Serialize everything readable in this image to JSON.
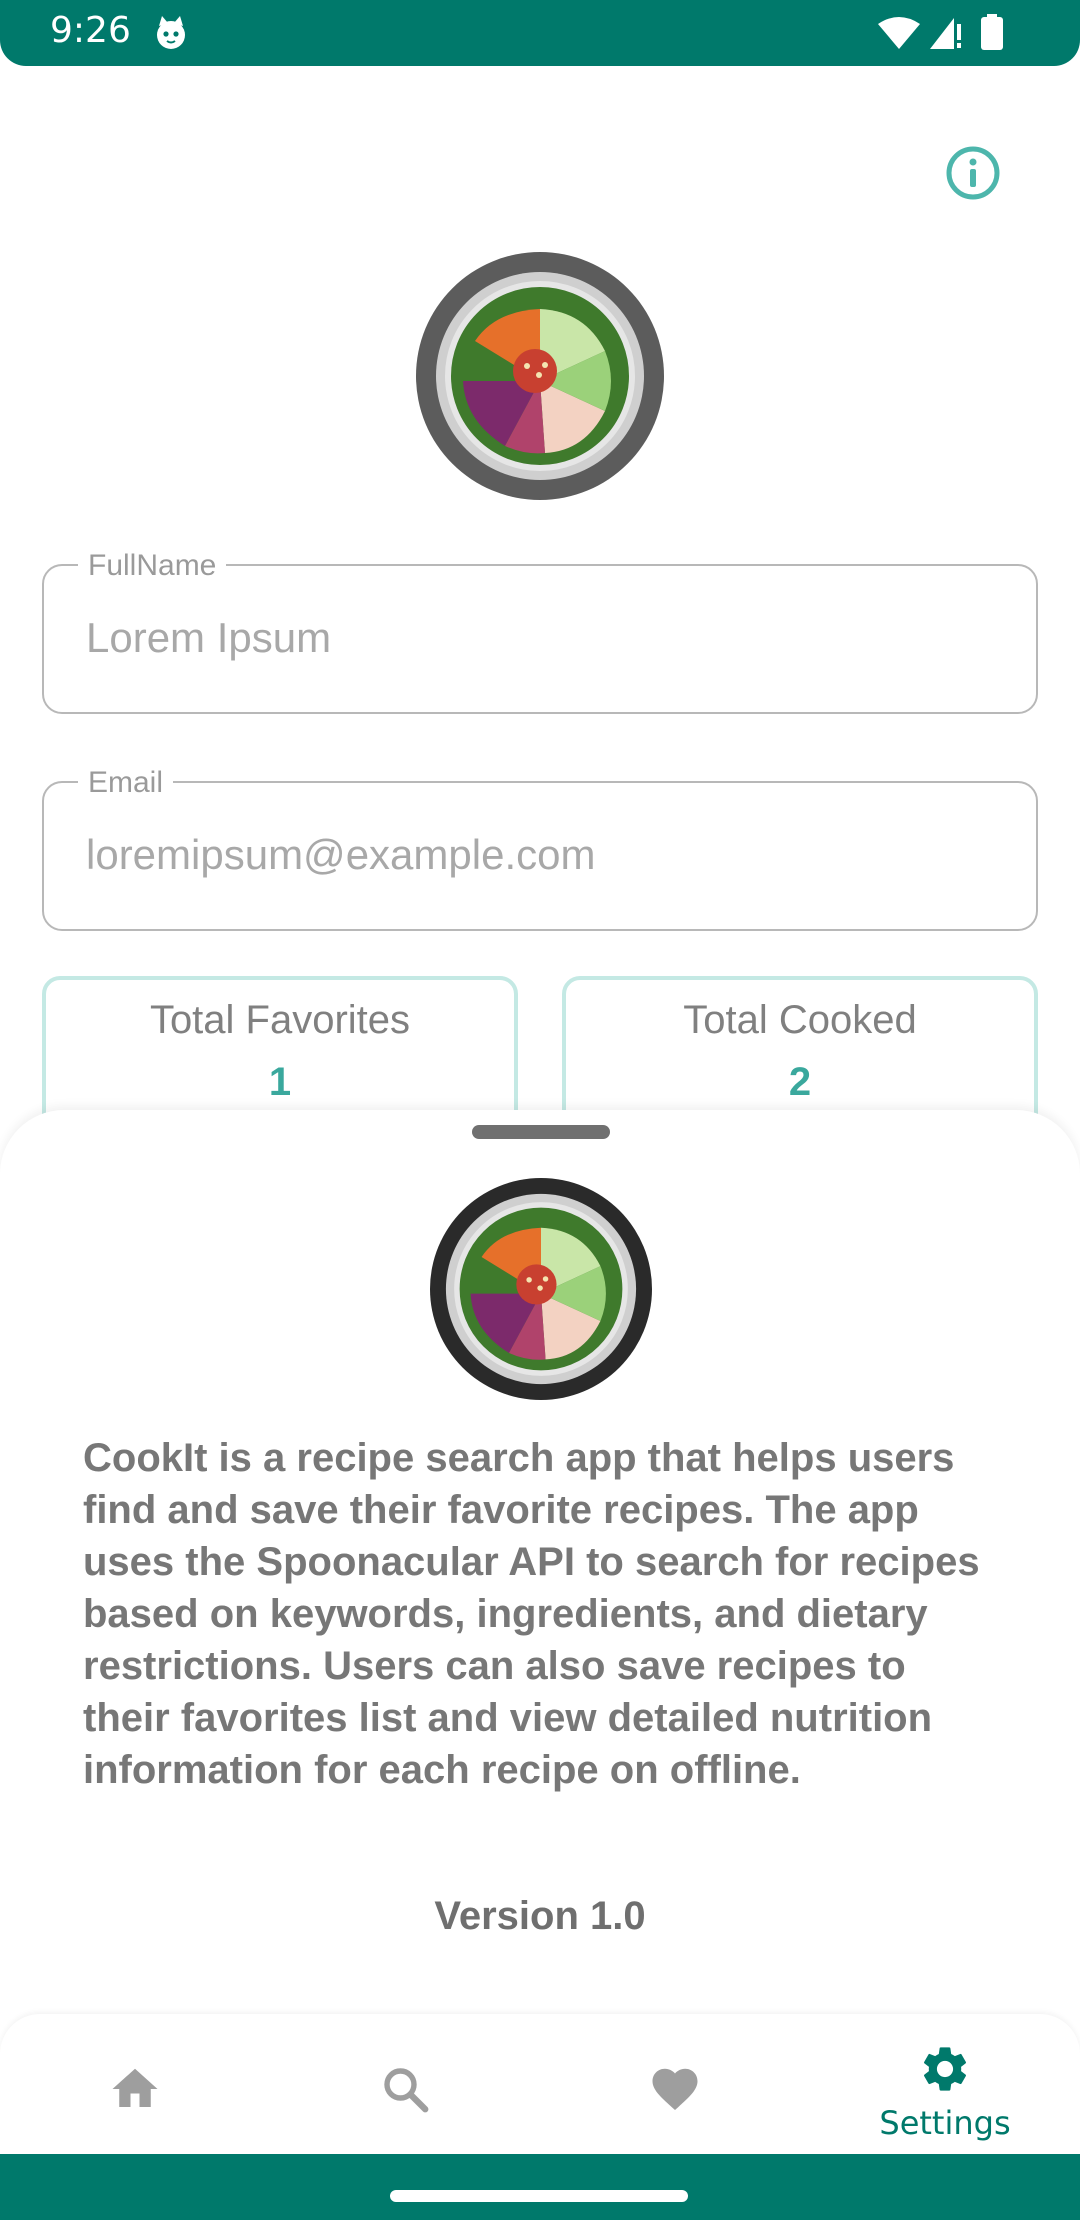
{
  "status_bar": {
    "time": "9:26"
  },
  "profile": {
    "fullname_label": "FullName",
    "fullname_value": "Lorem Ipsum",
    "email_label": "Email",
    "email_value": "loremipsum@example.com",
    "stats": [
      {
        "title": "Total Favorites",
        "value": "1"
      },
      {
        "title": "Total Cooked",
        "value": "2"
      }
    ]
  },
  "about_sheet": {
    "description": "CookIt is a recipe search app that helps users find and save their favorite recipes. The app uses the Spoonacular API to search for recipes based on keywords, ingredients, and dietary restrictions. Users can also save recipes to their favorites list and view detailed nutrition information for each recipe on offline.",
    "version": "Version 1.0"
  },
  "bottom_nav": {
    "items": [
      {
        "icon": "home-icon",
        "active": false
      },
      {
        "icon": "search-icon",
        "active": false
      },
      {
        "icon": "heart-icon",
        "active": false
      },
      {
        "icon": "gear-icon",
        "label": "Settings",
        "active": true
      }
    ]
  },
  "colors": {
    "primary": "#00796B",
    "accent": "#4DB6AC",
    "card_border": "#C4E9E4",
    "text_gray": "#777777"
  }
}
